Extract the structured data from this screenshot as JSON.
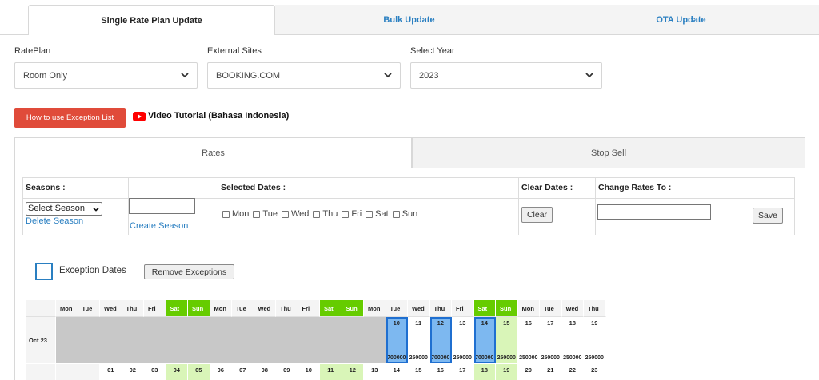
{
  "top_tabs": [
    "Single Rate Plan Update",
    "Bulk Update",
    "OTA Update"
  ],
  "fields": {
    "rateplan": {
      "label": "RatePlan",
      "value": "Room Only"
    },
    "external_sites": {
      "label": "External Sites",
      "value": "BOOKING.COM"
    },
    "select_year": {
      "label": "Select Year",
      "value": "2023"
    }
  },
  "exception_button": "How to use Exception List",
  "video_tutorial": "Video Tutorial (Bahasa Indonesia)",
  "inner_tabs": [
    "Rates",
    "Stop Sell"
  ],
  "rates_table": {
    "headers": {
      "seasons": "Seasons :",
      "selected_dates": "Selected Dates :",
      "clear_dates": "Clear Dates :",
      "change_rates": "Change Rates To :"
    },
    "season_select": "Select Season",
    "delete_season": "Delete Season",
    "create_season": "Create Season",
    "days": [
      "Mon",
      "Tue",
      "Wed",
      "Thu",
      "Fri",
      "Sat",
      "Sun"
    ],
    "clear_button": "Clear",
    "save_button": "Save"
  },
  "exceptions": {
    "label": "Exception Dates",
    "remove_button": "Remove Exceptions"
  },
  "calendar": {
    "weekday_headers": [
      "Mon",
      "Tue",
      "Wed",
      "Thu",
      "Fri",
      "Sat",
      "Sun",
      "Mon",
      "Tue",
      "Wed",
      "Thu",
      "Fri",
      "Sat",
      "Sun",
      "Mon",
      "Tue",
      "Wed",
      "Thu",
      "Fri",
      "Sat",
      "Sun",
      "Mon",
      "Tue",
      "Wed",
      "Thu"
    ],
    "month_label": "Oct 23",
    "row1_days": [
      "10",
      "11",
      "12",
      "13",
      "14",
      "15",
      "16",
      "17",
      "18",
      "19"
    ],
    "row1_rates": [
      "700000",
      "250000",
      "700000",
      "250000",
      "700000",
      "250000",
      "250000",
      "250000",
      "250000",
      "250000"
    ],
    "row1_highlight": [
      "blue",
      "none",
      "blue",
      "none",
      "blue",
      "green",
      "none",
      "none",
      "none",
      "none"
    ],
    "row2_days": [
      "01",
      "02",
      "03",
      "04",
      "05",
      "06",
      "07",
      "08",
      "09",
      "10",
      "11",
      "12",
      "13",
      "14",
      "15",
      "16",
      "17",
      "18",
      "19",
      "20",
      "21",
      "22",
      "23"
    ],
    "colors": {
      "weekend": "#66cc00",
      "selected": "#7db8f0",
      "weekend_light": "#d9f5b8"
    }
  }
}
